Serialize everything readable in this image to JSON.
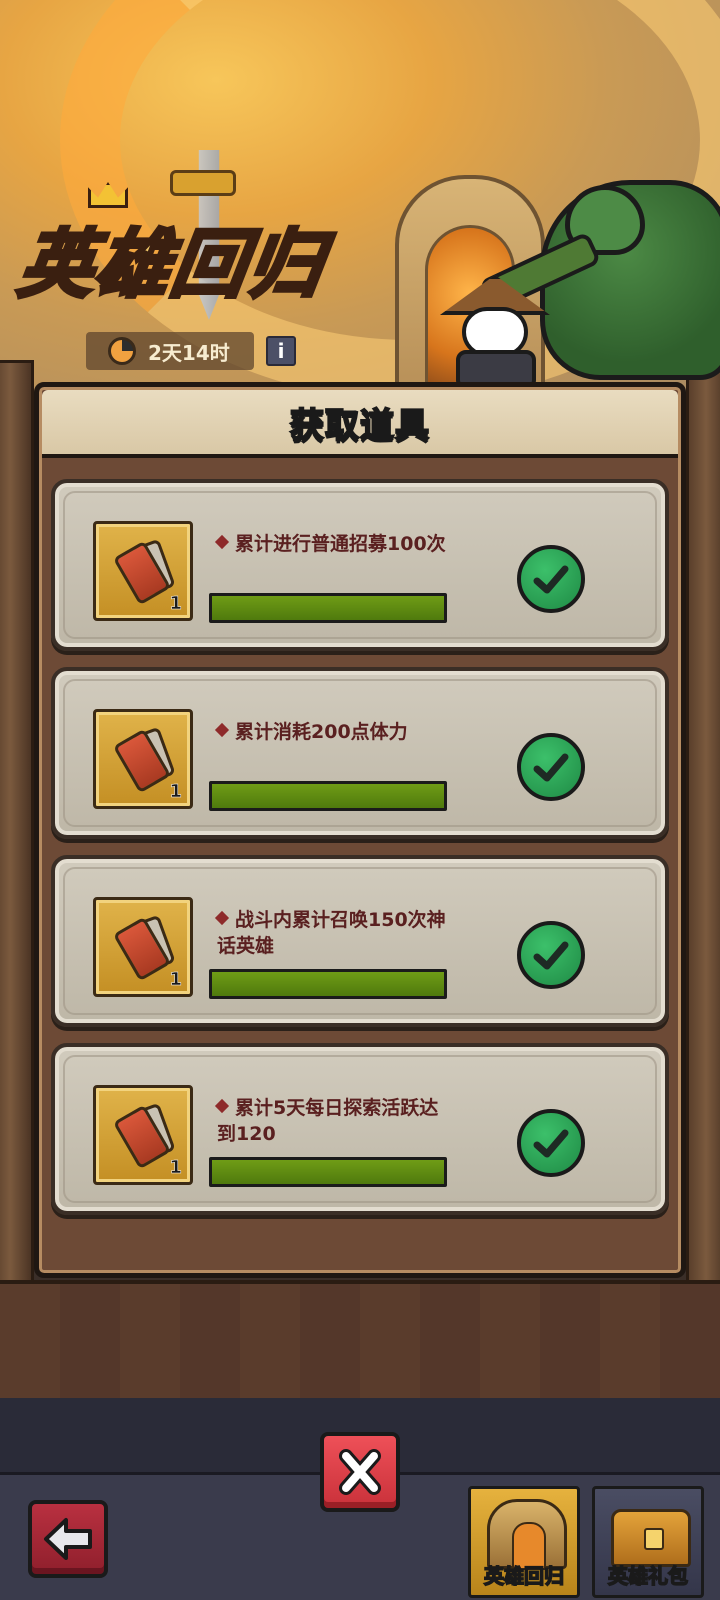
{
  "header": {
    "event_title": "英雄回归",
    "timer": "2天14时",
    "info_label": "i"
  },
  "panel": {
    "title": "获取道具",
    "tasks": [
      {
        "description": "累计进行普通招募100次",
        "item_count": "1",
        "progress": 1.0,
        "completed": true
      },
      {
        "description": "累计消耗200点体力",
        "item_count": "1",
        "progress": 1.0,
        "completed": true
      },
      {
        "description": "战斗内累计召唤150次神话英雄",
        "item_count": "1",
        "progress": 1.0,
        "completed": true
      },
      {
        "description": "累计5天每日探索活跃达到120",
        "item_count": "1",
        "progress": 1.0,
        "completed": true
      }
    ]
  },
  "bottom_nav": {
    "tabs": [
      {
        "label": "英雄回归",
        "active": true,
        "icon": "gate-icon"
      },
      {
        "label": "英雄礼包",
        "active": false,
        "icon": "chest-icon"
      }
    ]
  },
  "colors": {
    "progress_fill": "#5c8a10",
    "check_badge": "#27a052",
    "close_button": "#e0434c",
    "panel_brown": "#6d4a36"
  }
}
